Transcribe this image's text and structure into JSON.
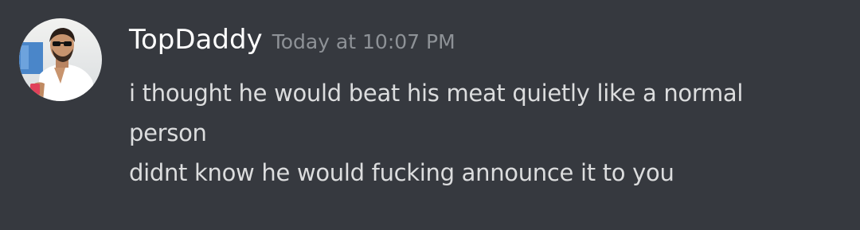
{
  "message": {
    "author": {
      "username": "TopDaddy",
      "avatar_icon": "user-avatar"
    },
    "timestamp": "Today at 10:07 PM",
    "lines": [
      "i thought he would beat his meat quietly like a normal",
      "person",
      "didnt know he would fucking announce it to you"
    ]
  },
  "colors": {
    "background": "#36393f",
    "username": "#ffffff",
    "timestamp": "#8e9297",
    "text": "#dcddde"
  }
}
